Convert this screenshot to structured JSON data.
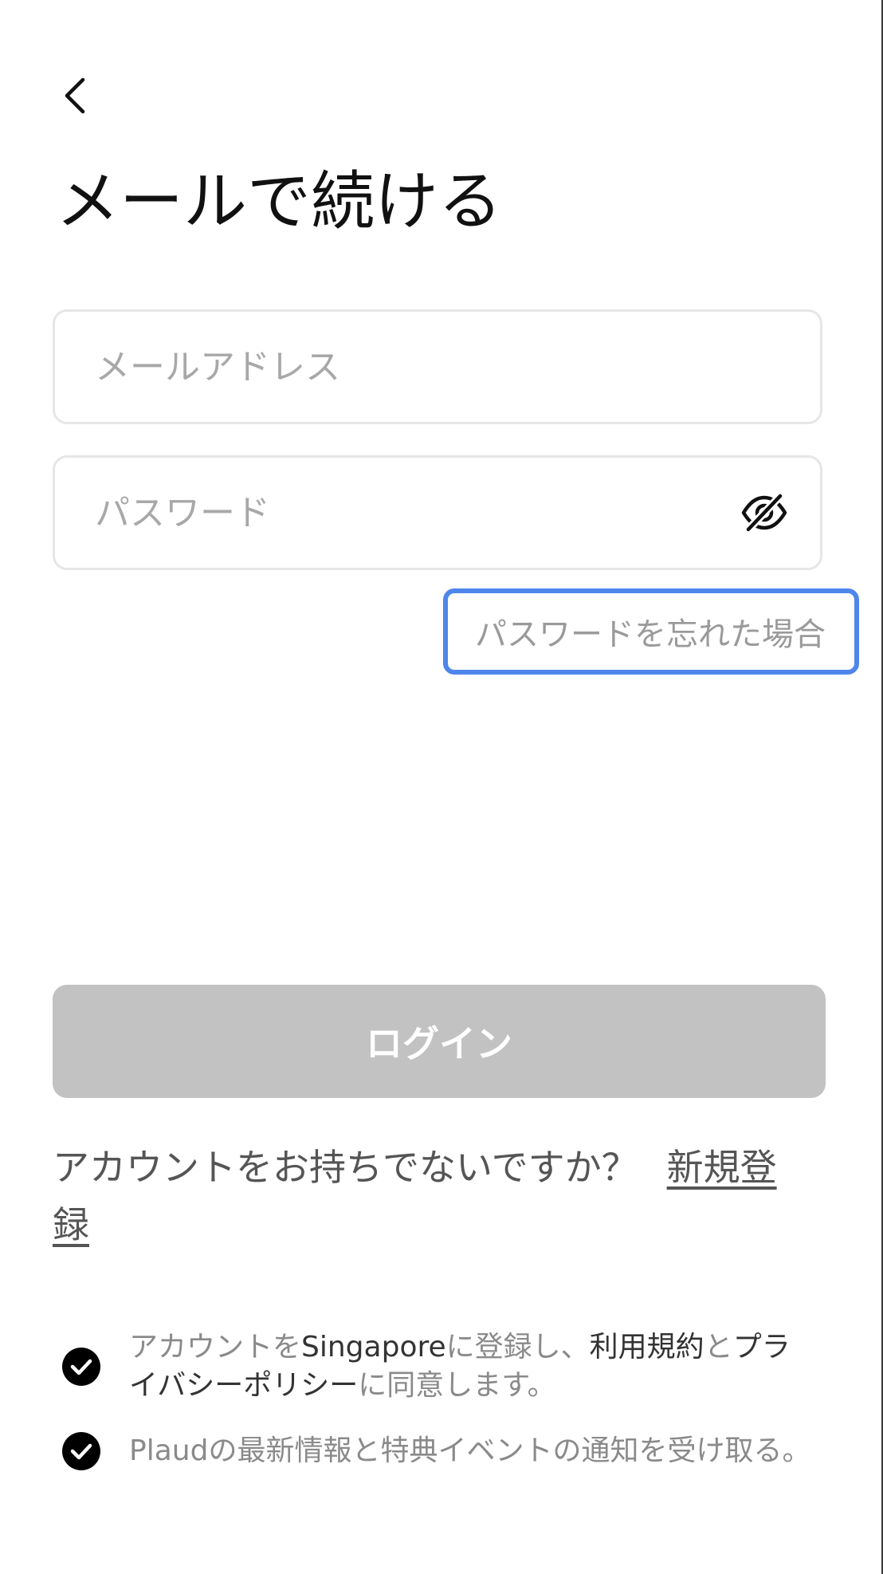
{
  "header": {
    "back_icon": "chevron-left-icon",
    "title": "メールで続ける"
  },
  "form": {
    "email_placeholder": "メールアドレス",
    "email_value": "",
    "password_placeholder": "パスワード",
    "password_value": "",
    "password_toggle_icon": "eye-off-icon",
    "forgot_label": "パスワードを忘れた場合",
    "login_label": "ログイン"
  },
  "signup": {
    "prompt": "アカウントをお持ちでないですか？",
    "link_label": "新規登録"
  },
  "consents": {
    "terms": {
      "checked": true,
      "prefix": "アカウントを",
      "region": "Singapore",
      "middle": "に登録し、",
      "terms_link": "利用規約",
      "and": "と",
      "privacy_link": "プライバシーポリシー",
      "suffix": "に同意します。"
    },
    "marketing": {
      "checked": true,
      "text": "Plaudの最新情報と特典イベントの通知を受け取る。"
    }
  },
  "colors": {
    "focus_outline": "#4f86ec",
    "button_disabled": "#c2c2c2",
    "placeholder": "#a8a8a8"
  }
}
